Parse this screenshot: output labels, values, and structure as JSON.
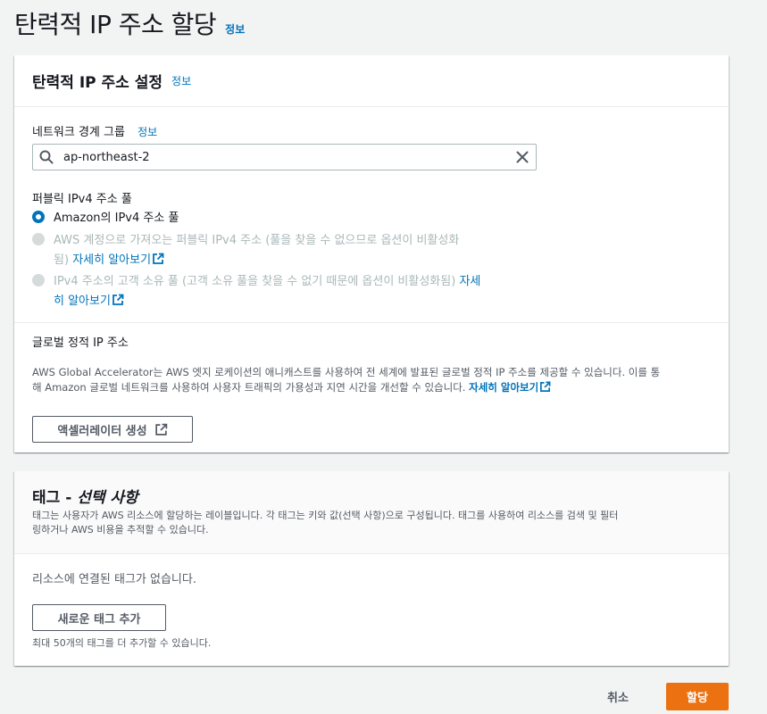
{
  "page": {
    "title": "탄력적 IP 주소 할당",
    "info": "정보"
  },
  "settings_panel": {
    "title": "탄력적 IP 주소 설정",
    "info": "정보",
    "network_border_group": {
      "label": "네트워크 경계 그룹",
      "info": "정보",
      "value": "ap-northeast-2"
    },
    "ipv4_pool": {
      "label": "퍼블릭 IPv4 주소 풀",
      "options": [
        {
          "label": "Amazon의 IPv4 주소 풀",
          "selected": true,
          "disabled": false
        },
        {
          "label_line1": "AWS 계정으로 가져오는 퍼블릭 IPv4 주소 (풀을 찾을 수 없으므로 옵션이 비활성화",
          "label_line2": "됨)",
          "link": "자세히 알아보기",
          "selected": false,
          "disabled": true
        },
        {
          "label_line1": "IPv4 주소의 고객 소유 풀 (고객 소유 풀을 찾을 수 없기 때문에 옵션이 비활성화됨)",
          "link_line1": "자세",
          "link_line2": "히 알아보기",
          "selected": false,
          "disabled": true
        }
      ]
    },
    "global_static_ip": {
      "label": "글로벌 정적 IP 주소",
      "description_line1": "AWS Global Accelerator는 AWS 엣지 로케이션의 애니캐스트를 사용하여 전 세계에 발표된 글로벌 정적 IP 주소를 제공할 수 있습니다. 이를 통",
      "description_line2": "해 Amazon 글로벌 네트워크를 사용하여 사용자 트래픽의 가용성과 지연 시간을 개선할 수 있습니다.",
      "link": "자세히 알아보기",
      "button": "액셀러레이터 생성"
    }
  },
  "tags_panel": {
    "title_prefix": "태그 -",
    "title_optional": "선택 사항",
    "description_line1": "태그는 사용자가 AWS 리소스에 할당하는 레이블입니다. 각 태그는 키와 값(선택 사항)으로 구성됩니다. 태그를 사용하여 리소스를 검색 및 필터",
    "description_line2": "링하거나 AWS 비용을 추적할 수 있습니다.",
    "empty_message": "리소스에 연결된 태그가 없습니다.",
    "add_button": "새로운 태그 추가",
    "limit_note": "최대 50개의 태그를 더 추가할 수 있습니다."
  },
  "footer": {
    "cancel": "취소",
    "submit": "할당"
  },
  "colors": {
    "link": "#0073bb",
    "primary": "#ec7211",
    "background": "#f2f3f3"
  },
  "icons": [
    "search-icon",
    "clear-icon",
    "external-link-icon"
  ]
}
